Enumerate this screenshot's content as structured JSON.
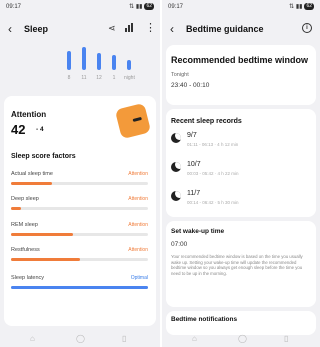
{
  "left": {
    "status": {
      "time": "09:17",
      "icons": "⇅ ▮▮",
      "battery": "62"
    },
    "app_title": "Sleep",
    "chart": {
      "bars": [
        {
          "label": "",
          "value": 0
        },
        {
          "label": "",
          "value": 0
        },
        {
          "label": "",
          "value": 0
        },
        {
          "label": "",
          "value": 0
        },
        {
          "label": "8",
          "value": 0.78
        },
        {
          "label": "11",
          "value": 0.95
        },
        {
          "label": "12",
          "value": 0.7
        },
        {
          "label": "1",
          "value": 0.62
        },
        {
          "label": "night",
          "value": 0.4
        }
      ]
    },
    "attention": {
      "title": "Attention",
      "score": "42",
      "delta": "- 4"
    },
    "factors": {
      "title": "Sleep score factors",
      "items": [
        {
          "label": "Actual sleep time",
          "status": "Attention",
          "fraction": 0.3,
          "color": "#f07c3a"
        },
        {
          "label": "Deep sleep",
          "status": "Attention",
          "fraction": 0.07,
          "color": "#f07c3a"
        },
        {
          "label": "REM sleep",
          "status": "Attention",
          "fraction": 0.45,
          "color": "#f07c3a"
        },
        {
          "label": "Restfulness",
          "status": "Attention",
          "fraction": 0.5,
          "color": "#f07c3a"
        },
        {
          "label": "Sleep latency",
          "status": "Optimal",
          "fraction": 1.0,
          "color": "#4a84f0"
        }
      ]
    }
  },
  "right": {
    "status": {
      "time": "09:17",
      "icons": "⇅ ▮▮",
      "battery": "62"
    },
    "app_title": "Bedtime guidance",
    "recommended": {
      "title": "Recommended bedtime window",
      "sub": "Tonight",
      "range": "23:40 - 00:10"
    },
    "records": {
      "title": "Recent sleep records",
      "items": [
        {
          "date": "9/7",
          "detail": "01:11 - 06:13 · 4 h 12 min"
        },
        {
          "date": "10/7",
          "detail": "00:03 - 05:42 · 4 h 22 min"
        },
        {
          "date": "11/7",
          "detail": "00:14 - 06:42 · 5 h 30 min"
        }
      ]
    },
    "wake": {
      "title": "Set wake-up time",
      "time": "07:00",
      "desc": "Your recommended bedtime window is based on the time you usually wake up. Setting your wake-up time will update the recommended bedtime window so you always get enough sleep before the time you need to be up in the morning."
    },
    "notifications": {
      "title": "Bedtime notifications"
    }
  },
  "nav": {
    "icons": [
      "⌂",
      "◯",
      "▯",
      "♡"
    ]
  },
  "colors": {
    "accent_blue": "#4a84f0",
    "attention_orange": "#f07c3a",
    "optimal_blue": "#3a7de8"
  }
}
